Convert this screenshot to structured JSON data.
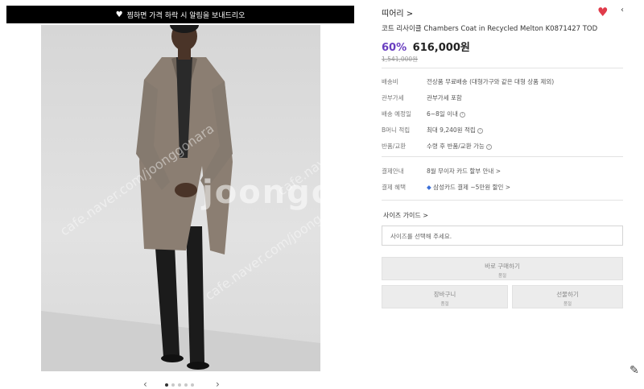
{
  "banner": {
    "icon": "heart-icon",
    "text": "찜하면 가격 하락 시 알림을 보내드리오"
  },
  "gallery": {
    "watermark": "joongo",
    "watermark_diag": "cafe.naver.com/joonggonara",
    "dots_total": 5,
    "dots_active": 1
  },
  "product": {
    "seller": "띠어리 >",
    "title": "코트 리사이클 Chambers Coat in Recycled Melton K0871427 TOD",
    "discount": "60%",
    "price": "616,000원",
    "original_price": "1,541,000원"
  },
  "specs": [
    {
      "key": "배송비",
      "value": "전상품 무료배송 (대형가구와 같은 대형 상품 제외)",
      "info": false
    },
    {
      "key": "관부가세",
      "value": "관부가세 포함",
      "info": false
    },
    {
      "key": "배송 예정일",
      "value": "6~8일 이내",
      "info": true
    },
    {
      "key": "B머니 적립",
      "value": "최대 9,240원 적립",
      "info": true
    },
    {
      "key": "반품/교환",
      "value": "수령 후 반품/교환 가능",
      "info": true
    }
  ],
  "payment": [
    {
      "key": "결제안내",
      "value": "8월 무이자 카드 할부 안내 >"
    },
    {
      "key": "결제 혜택",
      "value": "삼성카드 결제 ~5만원 할인 >"
    }
  ],
  "size": {
    "guide_label": "사이즈 가이드 >",
    "placeholder": "사이즈를 선택해 주세요."
  },
  "buttons": {
    "buy": {
      "label": "바로 구매하기",
      "sub": "품절"
    },
    "cart": {
      "label": "장바구니",
      "sub": "품절"
    },
    "gift": {
      "label": "선물하기",
      "sub": "품절"
    }
  },
  "colors": {
    "accent": "#6a3fc0",
    "wish": "#e03b4a"
  }
}
